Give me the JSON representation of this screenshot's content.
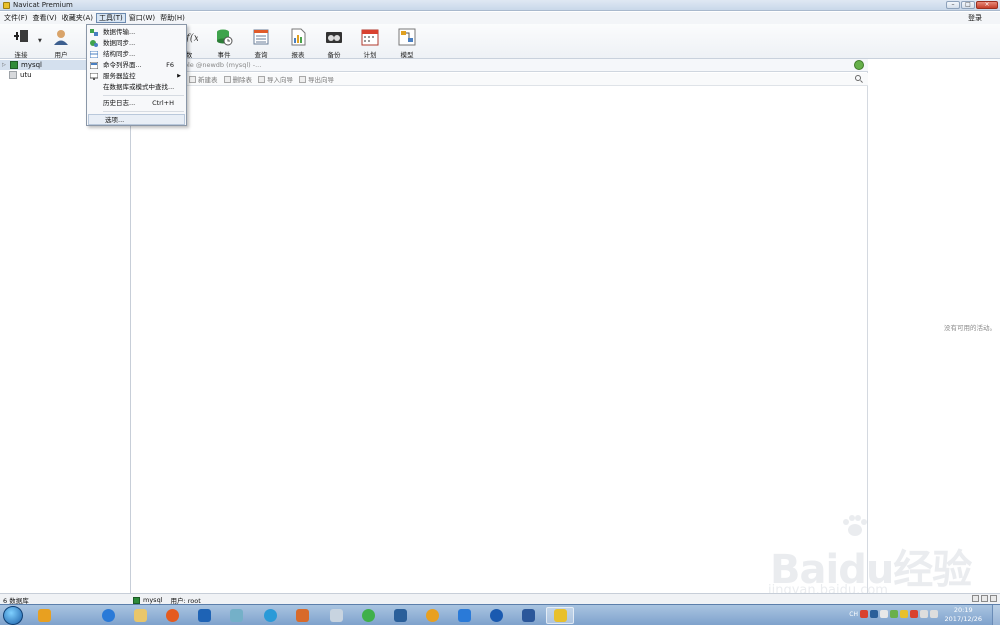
{
  "window": {
    "title": "Navicat Premium"
  },
  "menubar": {
    "items": [
      {
        "label": "文件(F)"
      },
      {
        "label": "查看(V)"
      },
      {
        "label": "收藏夹(A)"
      },
      {
        "label": "工具(T)"
      },
      {
        "label": "窗口(W)"
      },
      {
        "label": "帮助(H)"
      }
    ],
    "login_label": "登录"
  },
  "toolbar": {
    "connect": "连接",
    "user": "用户",
    "function_partial": "数",
    "event": "事件",
    "query": "查询",
    "report": "报表",
    "backup": "备份",
    "schedule": "计划",
    "model": "模型"
  },
  "tools_menu": {
    "data_transfer": "数据传输...",
    "data_sync": "数据同步...",
    "structure_sync": "结构同步...",
    "command_line": "命令列界面...",
    "command_line_shortcut": "F6",
    "server_monitor": "服务器监控",
    "find_in_db": "在数据库或模式中查找...",
    "history_log": "历史日志...",
    "history_log_shortcut": "Ctrl+H",
    "options": "选项..."
  },
  "tree": {
    "items": [
      {
        "label": "mysql"
      },
      {
        "label": "utu"
      }
    ]
  },
  "main": {
    "tab_text": "wtable @newdb (mysql) -...",
    "object_toolbar": {
      "open_partial": "计表",
      "new_table": "新建表",
      "delete_table": "删除表",
      "import_wizard": "导入向导",
      "export_wizard": "导出向导"
    }
  },
  "right_pane": {
    "no_activity": "没有可用的活动。"
  },
  "statusbar": {
    "db_count": "6 数据库",
    "connection": "mysql",
    "user": "用户: root"
  },
  "taskbar": {
    "clock_time": "20:19",
    "clock_date": "2017/12/26",
    "tray_lang": "CH"
  },
  "watermark": {
    "brand": "Baidu经验",
    "url": "jingyan.baidu.com"
  },
  "colors": {
    "selection": "#d4e0ee",
    "taskbar": "#7fa2cc",
    "mysql_icon": "#2e8b3a"
  }
}
